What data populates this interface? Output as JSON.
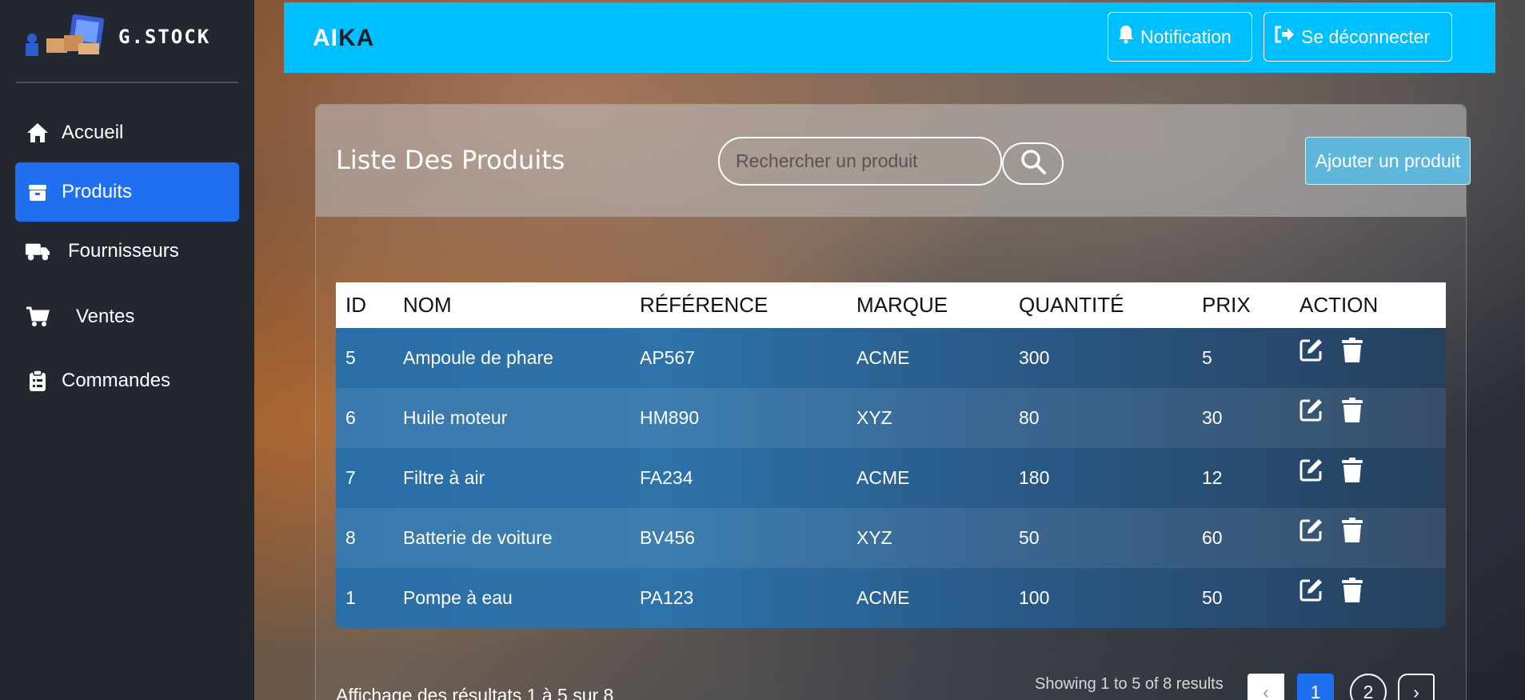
{
  "brand": {
    "name": "G.STOCK"
  },
  "sidebar": {
    "items": [
      {
        "label": "Accueil",
        "icon": "home-icon"
      },
      {
        "label": "Produits",
        "icon": "box-icon",
        "active": true
      },
      {
        "label": "Fournisseurs",
        "icon": "truck-icon"
      },
      {
        "label": "Ventes",
        "icon": "cart-icon"
      },
      {
        "label": "Commandes",
        "icon": "clipboard-icon"
      }
    ]
  },
  "header": {
    "logo_light": "AI",
    "logo_dark": "KA",
    "notification_label": "Notification",
    "logout_label": "Se déconnecter"
  },
  "products": {
    "title": "Liste Des Produits",
    "search_placeholder": "Rechercher un produit",
    "add_label": "Ajouter un produit",
    "columns": [
      "ID",
      "NOM",
      "RÉFÉRENCE",
      "MARQUE",
      "QUANTITÉ",
      "PRIX",
      "ACTION"
    ],
    "rows": [
      {
        "id": "5",
        "nom": "Ampoule de phare",
        "reference": "AP567",
        "marque": "ACME",
        "quantite": "300",
        "prix": "5"
      },
      {
        "id": "6",
        "nom": "Huile moteur",
        "reference": "HM890",
        "marque": "XYZ",
        "quantite": "80",
        "prix": "30"
      },
      {
        "id": "7",
        "nom": "Filtre à air",
        "reference": "FA234",
        "marque": "ACME",
        "quantite": "180",
        "prix": "12"
      },
      {
        "id": "8",
        "nom": "Batterie de voiture",
        "reference": "BV456",
        "marque": "XYZ",
        "quantite": "50",
        "prix": "60"
      },
      {
        "id": "1",
        "nom": "Pompe à eau",
        "reference": "PA123",
        "marque": "ACME",
        "quantite": "100",
        "prix": "50"
      }
    ]
  },
  "footer": {
    "summary_fr": "Affichage des résultats 1 à 5 sur 8",
    "summary_en": "Showing 1 to 5 of 8 results",
    "prev": "‹",
    "pages": [
      "1",
      "2"
    ],
    "next": "›",
    "current_page": "1"
  },
  "colors": {
    "accent": "#00bfff",
    "active": "#1f6ff0",
    "sidebar": "#23272f"
  }
}
